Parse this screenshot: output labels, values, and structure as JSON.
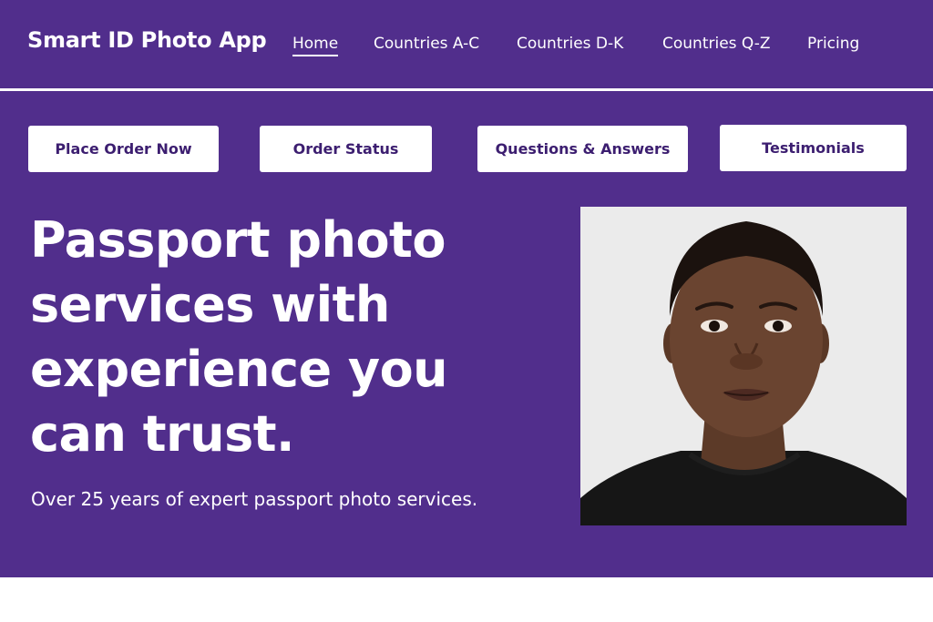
{
  "header": {
    "brand": "Smart ID Photo App",
    "nav": [
      {
        "label": "Home",
        "active": true
      },
      {
        "label": "Countries A-C"
      },
      {
        "label": "Countries D-K"
      },
      {
        "label": "Countries Q-Z"
      },
      {
        "label": "Pricing"
      }
    ]
  },
  "actions": [
    {
      "label": "Place Order Now"
    },
    {
      "label": "Order Status"
    },
    {
      "label": "Questions & Answers"
    },
    {
      "label": "Testimonials"
    }
  ],
  "hero": {
    "headline": "Passport photo services with experience you can trust.",
    "subheadline": "Over 25 years of expert passport photo services."
  },
  "colors": {
    "background": "#512e8c",
    "button_text": "#3c1e70",
    "text": "#ffffff"
  }
}
